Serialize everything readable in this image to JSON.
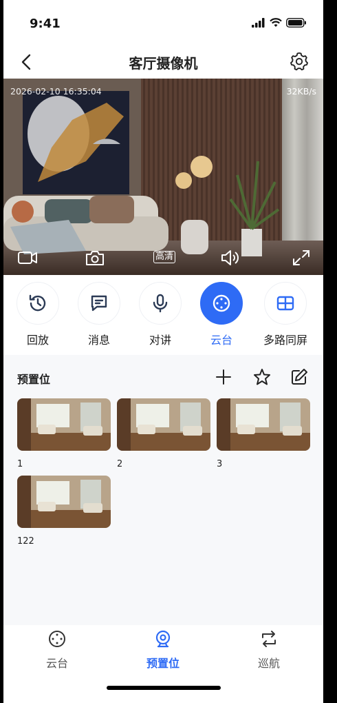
{
  "status_bar": {
    "time": "9:41"
  },
  "header": {
    "title": "客厅摄像机"
  },
  "video": {
    "timestamp": "2026-02-10 16:35:04",
    "bitrate": "32KB/s",
    "quality_label": "高清"
  },
  "features": [
    {
      "label": "回放",
      "icon": "history-icon",
      "active": false
    },
    {
      "label": "消息",
      "icon": "message-icon",
      "active": false
    },
    {
      "label": "对讲",
      "icon": "microphone-icon",
      "active": false
    },
    {
      "label": "云台",
      "icon": "ptz-icon",
      "active": true
    },
    {
      "label": "多路同屏",
      "icon": "grid-icon",
      "active": false
    }
  ],
  "presets": {
    "title": "预置位",
    "items": [
      {
        "label": "1"
      },
      {
        "label": "2"
      },
      {
        "label": "3"
      },
      {
        "label": "122"
      }
    ]
  },
  "tabs": [
    {
      "label": "云台",
      "icon": "ptz-icon",
      "active": false
    },
    {
      "label": "预置位",
      "icon": "camera-preset-icon",
      "active": true
    },
    {
      "label": "巡航",
      "icon": "cruise-icon",
      "active": false
    }
  ],
  "colors": {
    "accent": "#2e6bf5",
    "panel_bg": "#f7f8fa"
  }
}
